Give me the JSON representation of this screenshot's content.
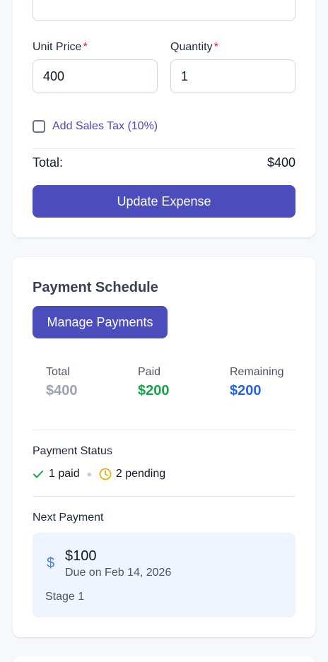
{
  "expense_form": {
    "unit_price_label": "Unit Price",
    "required_marker": "*",
    "unit_price_value": "400",
    "quantity_label": "Quantity",
    "quantity_value": "1",
    "sales_tax_label": "Add Sales Tax (10%)",
    "sales_tax_checked": false,
    "total_label": "Total:",
    "total_value": "$400",
    "submit_label": "Update Expense"
  },
  "payment_schedule": {
    "title": "Payment Schedule",
    "manage_label": "Manage Payments",
    "summary": {
      "total_label": "Total",
      "total_value": "$400",
      "paid_label": "Paid",
      "paid_value": "$200",
      "remaining_label": "Remaining",
      "remaining_value": "$200"
    },
    "status_heading": "Payment Status",
    "paid_count": "1 paid",
    "pending_count": "2 pending",
    "next_heading": "Next Payment",
    "next_amount": "$100",
    "next_due": "Due on Feb 14, 2026",
    "next_stage": "Stage 1"
  },
  "icons": {
    "paid": "check-icon",
    "pending": "clock-icon",
    "next_payment": "dollar-icon"
  },
  "colors": {
    "primary": "#4b4dbd",
    "paid": "#16a34a",
    "remaining": "#2563eb",
    "total_muted": "#9ca3af",
    "pending": "#eab308",
    "required": "#e11d48",
    "next_payment_bg": "#eef5fe"
  }
}
